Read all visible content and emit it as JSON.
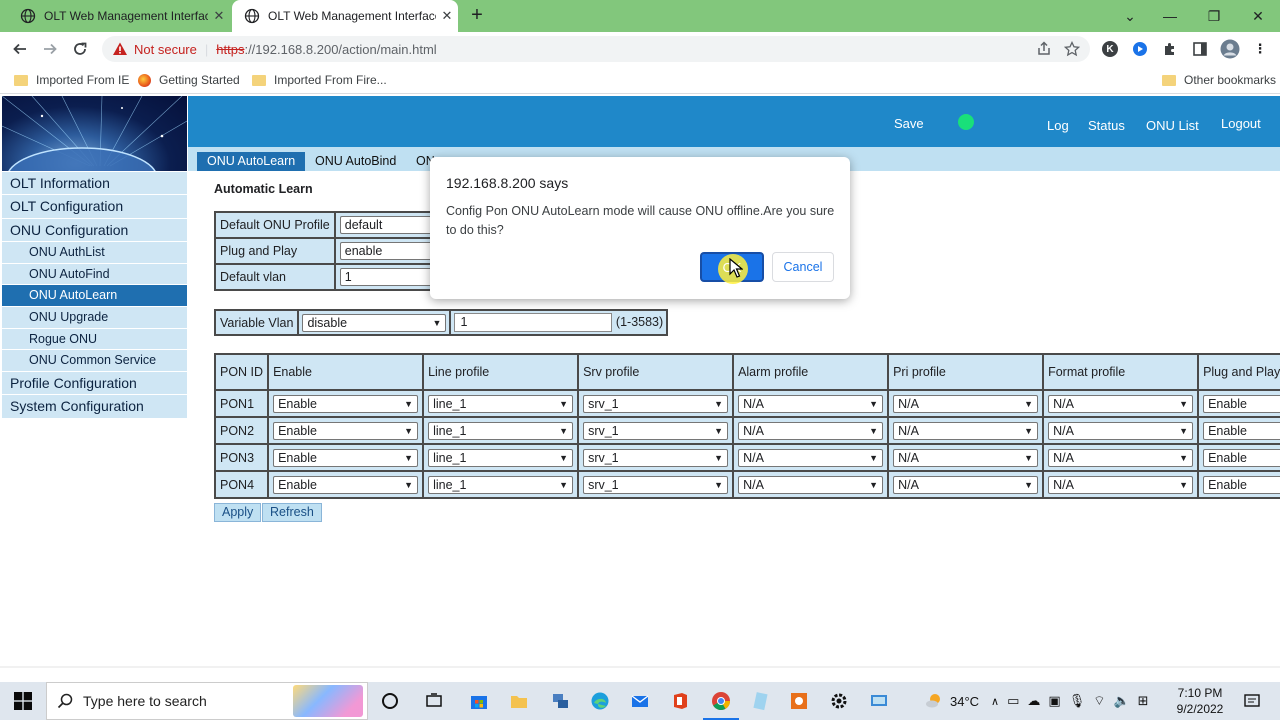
{
  "browser": {
    "tabs": [
      {
        "title": "OLT Web Management Interface",
        "active": false
      },
      {
        "title": "OLT Web Management Interface",
        "active": true
      }
    ],
    "omnibox": {
      "security": "Not secure",
      "scheme": "https",
      "rest": "://192.168.8.200/action/main.html"
    },
    "bookmarks": [
      "Imported From IE",
      "Getting Started",
      "Imported From Fire...",
      "Other bookmarks"
    ],
    "profile_initial": "K"
  },
  "header": {
    "links": {
      "save": "Save",
      "log": "Log",
      "status": "Status",
      "onu_list": "ONU List",
      "logout": "Logout"
    },
    "status_color": "#19e07a",
    "accent": "#1f88c9"
  },
  "subtabs": [
    "ONU AutoLearn",
    "ONU AutoBind",
    "ON"
  ],
  "sidebar": {
    "items": [
      {
        "label": "OLT Information",
        "level": 1
      },
      {
        "label": "OLT Configuration",
        "level": 1
      },
      {
        "label": "ONU Configuration",
        "level": 1
      },
      {
        "label": "ONU AuthList",
        "level": 2
      },
      {
        "label": "ONU AutoFind",
        "level": 2
      },
      {
        "label": "ONU AutoLearn",
        "level": 2,
        "active": true
      },
      {
        "label": "ONU Upgrade",
        "level": 2
      },
      {
        "label": "Rogue ONU",
        "level": 2
      },
      {
        "label": "ONU Common Service",
        "level": 2
      },
      {
        "label": "Profile Configuration",
        "level": 1
      },
      {
        "label": "System Configuration",
        "level": 1
      }
    ]
  },
  "autolearn": {
    "title": "Automatic Learn",
    "default_onu_profile": {
      "label": "Default ONU Profile",
      "value": "default"
    },
    "plug_and_play": {
      "label": "Plug and Play",
      "value": "enable"
    },
    "default_vlan": {
      "label": "Default vlan",
      "value": "1"
    },
    "variable_vlan": {
      "label": "Variable Vlan",
      "mode": "disable",
      "value": "1",
      "range": "(1-3583)"
    },
    "table": {
      "headers": [
        "PON ID",
        "Enable",
        "Line profile",
        "Srv profile",
        "Alarm profile",
        "Pri profile",
        "Format profile",
        "Plug and Play"
      ],
      "rows": [
        {
          "pon": "PON1",
          "enable": "Enable",
          "line": "line_1",
          "srv": "srv_1",
          "alarm": "N/A",
          "pri": "N/A",
          "format": "N/A",
          "pnp": "Enable"
        },
        {
          "pon": "PON2",
          "enable": "Enable",
          "line": "line_1",
          "srv": "srv_1",
          "alarm": "N/A",
          "pri": "N/A",
          "format": "N/A",
          "pnp": "Enable"
        },
        {
          "pon": "PON3",
          "enable": "Enable",
          "line": "line_1",
          "srv": "srv_1",
          "alarm": "N/A",
          "pri": "N/A",
          "format": "N/A",
          "pnp": "Enable"
        },
        {
          "pon": "PON4",
          "enable": "Enable",
          "line": "line_1",
          "srv": "srv_1",
          "alarm": "N/A",
          "pri": "N/A",
          "format": "N/A",
          "pnp": "Enable"
        }
      ]
    },
    "buttons": {
      "apply": "Apply",
      "refresh": "Refresh"
    }
  },
  "dialog": {
    "title": "192.168.8.200 says",
    "message": "Config Pon ONU AutoLearn mode will cause ONU offline.Are you sure to do this?",
    "ok": "OK",
    "cancel": "Cancel"
  },
  "taskbar": {
    "search_placeholder": "Type here to search",
    "temperature": "34°C",
    "time": "7:10 PM",
    "date": "9/2/2022"
  }
}
